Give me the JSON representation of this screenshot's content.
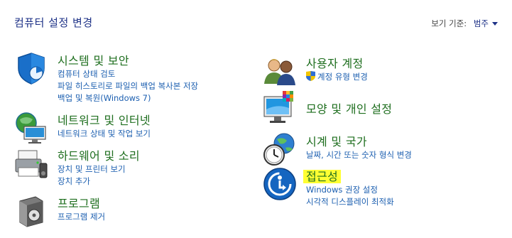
{
  "header": {
    "title": "컴퓨터 설정 변경",
    "view_by_label": "보기 기준:",
    "view_by_value": "범주"
  },
  "categories_left": [
    {
      "title": "시스템 및 보안",
      "icon": "system-security-shield-icon",
      "links": [
        "컴퓨터 상태 검토",
        "파일 히스토리로 파일의 백업 복사본 저장",
        "백업 및 복원(Windows 7)"
      ]
    },
    {
      "title": "네트워크 및 인터넷",
      "icon": "network-globe-icon",
      "links": [
        "네트워크 상태 및 작업 보기"
      ]
    },
    {
      "title": "하드웨어 및 소리",
      "icon": "hardware-printer-icon",
      "links": [
        "장치 및 프린터 보기",
        "장치 추가"
      ]
    },
    {
      "title": "프로그램",
      "icon": "programs-box-icon",
      "links": [
        "프로그램 제거"
      ]
    }
  ],
  "categories_right": [
    {
      "title": "사용자 계정",
      "icon": "user-accounts-icon",
      "links": [
        "계정 유형 변경"
      ]
    },
    {
      "title": "모양 및 개인 설정",
      "icon": "appearance-monitor-icon",
      "links": []
    },
    {
      "title": "시계 및 국가",
      "icon": "clock-globe-icon",
      "links": [
        "날짜, 시간 또는 숫자 형식 변경"
      ]
    },
    {
      "title": "접근성",
      "icon": "ease-of-access-icon",
      "links": [
        "Windows 권장 설정",
        "시각적 디스플레이 최적화"
      ]
    }
  ],
  "colors": {
    "title_green": "#1e6e1e",
    "link_blue": "#1c5fb0",
    "header_blue": "#1e3287",
    "highlight": "#ffff33"
  }
}
